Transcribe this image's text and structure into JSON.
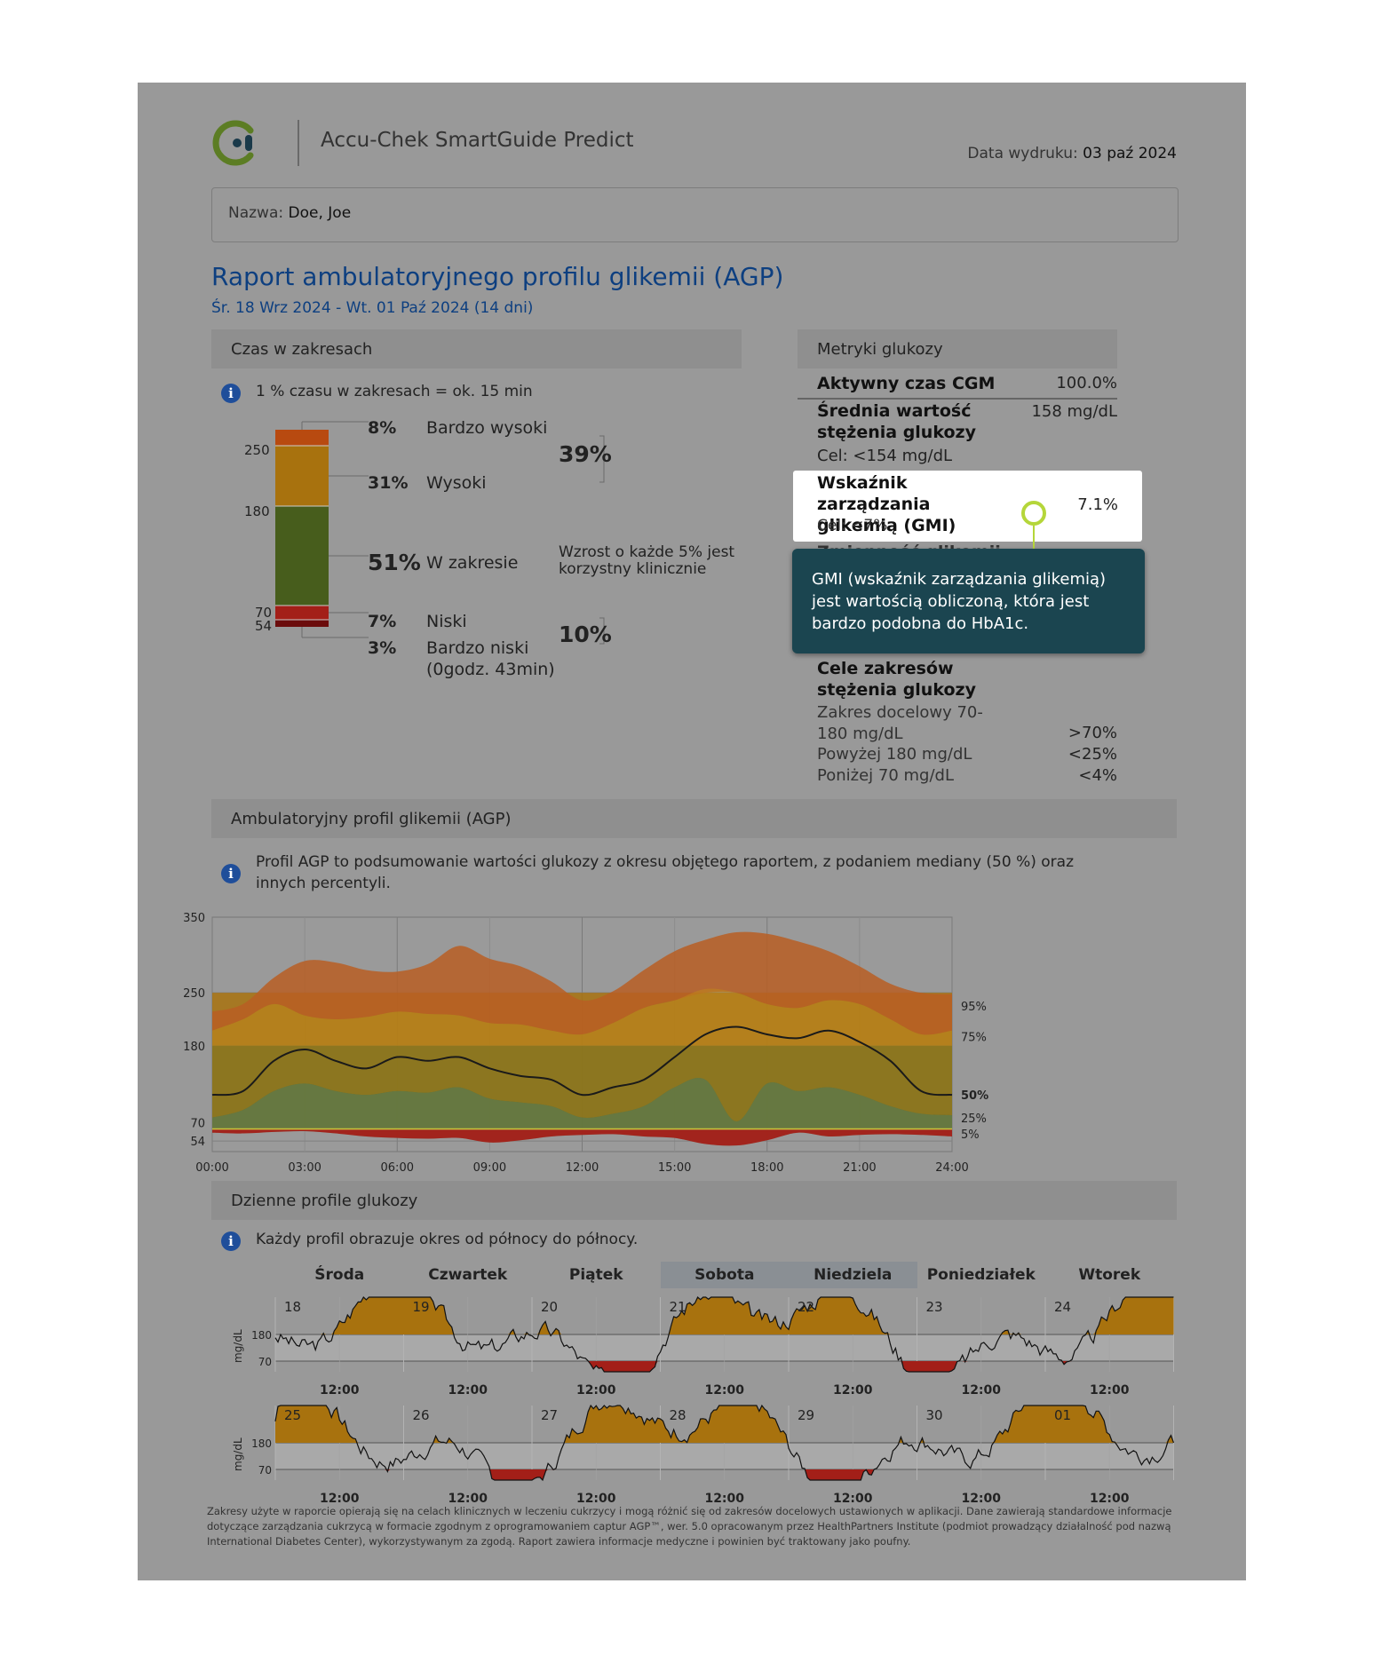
{
  "app_title": "Accu-Chek SmartGuide Predict",
  "print_date": {
    "label": "Data wydruku:",
    "value": "03 paź 2024"
  },
  "patient": {
    "label": "Nazwa:",
    "value": "Doe, Joe"
  },
  "report": {
    "title": "Raport ambulatoryjnego profilu glikemii (AGP)",
    "range": "Śr. 18 Wrz 2024 - Wt. 01 Paź 2024 (14 dni)"
  },
  "time_in_range": {
    "section_title": "Czas w zakresach",
    "info": "1 % czasu w zakresach = ok. 15 min",
    "thresholds": [
      "250",
      "180",
      "70",
      "54"
    ],
    "rows": [
      {
        "pct": "8%",
        "label": "Bardzo wysoki"
      },
      {
        "pct": "31%",
        "label": "Wysoki"
      },
      {
        "pct": "51%",
        "label": "W zakresie"
      },
      {
        "pct": "7%",
        "label": "Niski"
      },
      {
        "pct": "3%",
        "label": "Bardzo niski",
        "sub": "(0godz. 43min)"
      }
    ],
    "high_total": "39%",
    "low_total": "10%",
    "note": "Wzrost o każde 5% jest korzystny klinicznie",
    "colors": {
      "very_high": "#b84a10",
      "high": "#a8720e",
      "in_range": "#475d1c",
      "low": "#a31f18",
      "very_low": "#6b0c0c"
    }
  },
  "metrics": {
    "section_title": "Metryki glukozy",
    "active_cgm": {
      "label": "Aktywny czas CGM",
      "value": "100.0%"
    },
    "mean": {
      "label": "Średnia wartość stężenia glukozy",
      "value": "158 mg/dL",
      "target": "Cel: <154 mg/dL"
    },
    "gmi": {
      "label": "Wskaźnik zarządzania glikemią (GMI)",
      "value": "7.1%",
      "target": "Cel: <7%"
    },
    "hidden_label": "Zmienność glikemii",
    "targets_title": "Cele zakresów stężenia glukozy",
    "targets": [
      {
        "label": "Zakres docelowy 70-180 mg/dL",
        "value": ">70%"
      },
      {
        "label": "Powyżej 180 mg/dL",
        "value": "<25%"
      },
      {
        "label": "Poniżej 70 mg/dL",
        "value": "<4%"
      }
    ]
  },
  "tooltip": {
    "text": "GMI (wskaźnik zarządzania glikemią) jest wartością obliczoną, która jest bardzo podobna do HbA1c."
  },
  "agp": {
    "section_title": "Ambulatoryjny profil glikemii (AGP)",
    "info": "Profil AGP to podsumowanie wartości glukozy z okresu objętego raportem, z podaniem mediany (50 %) oraz innych percentyli.",
    "y_ticks": [
      "350",
      "250",
      "180",
      "70",
      "54"
    ],
    "x_ticks": [
      "00:00",
      "03:00",
      "06:00",
      "09:00",
      "12:00",
      "15:00",
      "18:00",
      "21:00",
      "24:00"
    ],
    "percentile_labels": [
      "95%",
      "75%",
      "50%",
      "25%",
      "5%"
    ]
  },
  "daily": {
    "section_title": "Dzienne profile glukozy",
    "info": "Każdy profil obrazuje okres od północy do północy.",
    "weekdays": [
      "Środa",
      "Czwartek",
      "Piątek",
      "Sobota",
      "Niedziela",
      "Poniedziałek",
      "Wtorek"
    ],
    "week1_dates": [
      "18",
      "19",
      "20",
      "21",
      "22",
      "23",
      "24"
    ],
    "week2_dates": [
      "25",
      "26",
      "27",
      "28",
      "29",
      "30",
      "01"
    ],
    "noon_label": "12:00",
    "unit": "mg/dL",
    "y_ticks": [
      "180",
      "70"
    ]
  },
  "footer": "Zakresy użyte w raporcie opierają się na celach klinicznych w leczeniu cukrzycy i mogą różnić się od zakresów docelowych ustawionych w aplikacji. Dane zawierają standardowe informacje dotyczące zarządzania cukrzycą w formacie zgodnym z oprogramowaniem captur AGP™, wer. 5.0 opracowanym przez HealthPartners Institute (podmiot prowadzący działalność pod nazwą International Diabetes Center), wykorzystywanym za zgodą. Raport zawiera informacje medyczne i powinien być traktowany jako poufny.",
  "chart_data": {
    "type": "area",
    "x": [
      0,
      1,
      2,
      3,
      4,
      5,
      6,
      7,
      8,
      9,
      10,
      11,
      12,
      13,
      14,
      15,
      16,
      17,
      18,
      19,
      20,
      21,
      22,
      23,
      24
    ],
    "ylim": [
      40,
      350
    ],
    "series": [
      {
        "name": "95%",
        "values": [
          225,
          235,
          270,
          292,
          290,
          280,
          278,
          288,
          312,
          295,
          285,
          265,
          240,
          252,
          280,
          305,
          320,
          330,
          328,
          318,
          305,
          285,
          262,
          250,
          248
        ]
      },
      {
        "name": "75%",
        "values": [
          200,
          215,
          235,
          220,
          215,
          218,
          225,
          222,
          220,
          210,
          208,
          200,
          195,
          210,
          230,
          240,
          255,
          250,
          235,
          230,
          240,
          235,
          215,
          195,
          200
        ]
      },
      {
        "name": "50%",
        "values": [
          115,
          120,
          160,
          175,
          160,
          150,
          165,
          160,
          165,
          150,
          140,
          135,
          115,
          125,
          135,
          165,
          195,
          205,
          195,
          190,
          200,
          185,
          160,
          120,
          115
        ]
      },
      {
        "name": "25%",
        "values": [
          85,
          95,
          120,
          130,
          120,
          115,
          120,
          118,
          125,
          110,
          105,
          100,
          85,
          90,
          100,
          125,
          135,
          80,
          130,
          120,
          125,
          115,
          100,
          90,
          88
        ]
      },
      {
        "name": "5%",
        "values": [
          65,
          64,
          66,
          67,
          64,
          60,
          58,
          57,
          58,
          52,
          55,
          60,
          62,
          63,
          60,
          58,
          50,
          48,
          55,
          65,
          60,
          62,
          63,
          62,
          60
        ]
      }
    ]
  }
}
